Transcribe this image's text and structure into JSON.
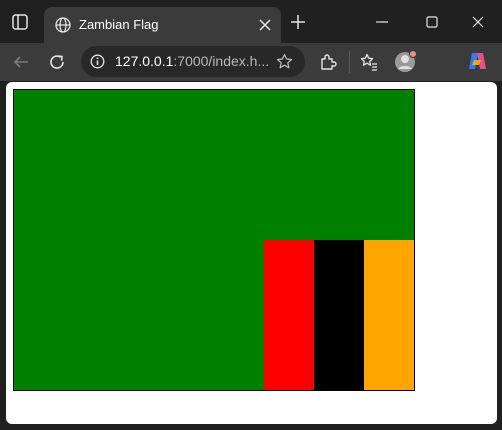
{
  "tab": {
    "title": "Zambian Flag"
  },
  "address": {
    "host": "127.0.0.1",
    "rest": ":7000/index.h..."
  },
  "flag": {
    "field_color": "#008000",
    "stripes": [
      {
        "name": "red",
        "color": "#ff0000"
      },
      {
        "name": "black",
        "color": "#000000"
      },
      {
        "name": "orange",
        "color": "#ffa500"
      }
    ]
  },
  "icons": {
    "sidebar": "sidebar-icon",
    "favicon": "globe-icon",
    "close_tab": "close-icon",
    "new_tab": "plus-icon",
    "back": "arrow-left-icon",
    "reload": "reload-icon",
    "info": "info-icon",
    "star": "star-icon",
    "extensions": "puzzle-icon",
    "favorites": "favorites-icon",
    "profile": "avatar-icon",
    "copilot": "copilot-icon"
  }
}
